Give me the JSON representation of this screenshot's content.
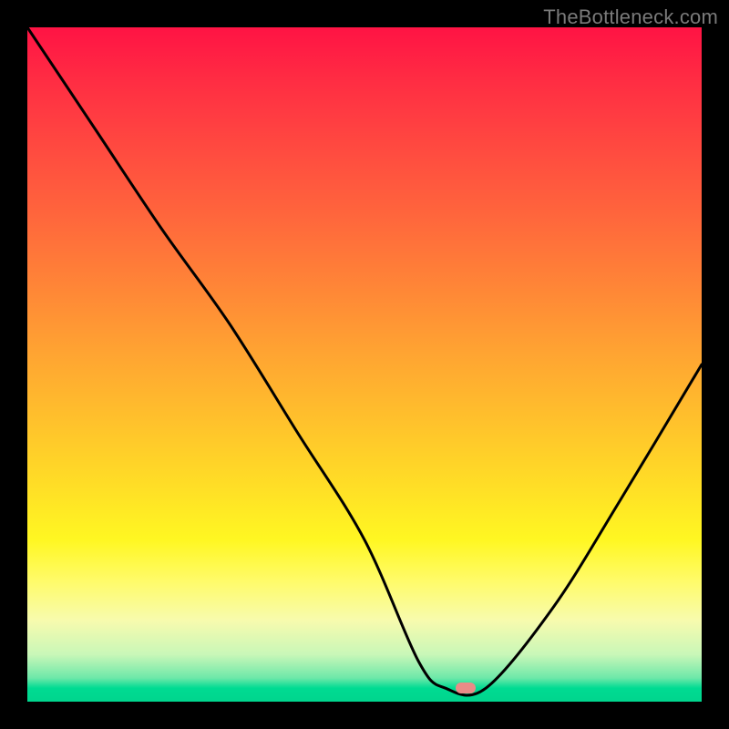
{
  "watermark": "TheBottleneck.com",
  "chart_data": {
    "type": "line",
    "title": "",
    "xlabel": "",
    "ylabel": "",
    "xlim": [
      0,
      100
    ],
    "ylim": [
      0,
      100
    ],
    "grid": false,
    "legend": false,
    "colors": {
      "gradient_top": "#ff1344",
      "gradient_bottom": "#00d58d",
      "line": "#000000",
      "marker": "#ea8b87",
      "background_outer": "#000000"
    },
    "marker": {
      "x": 65,
      "y": 2
    },
    "series": [
      {
        "name": "bottleneck-curve",
        "x": [
          0,
          10,
          20,
          30,
          40,
          50,
          58,
          62,
          68,
          78,
          88,
          100
        ],
        "values": [
          100,
          85,
          70,
          56,
          40,
          24,
          6,
          2,
          2,
          14,
          30,
          50
        ]
      }
    ]
  }
}
